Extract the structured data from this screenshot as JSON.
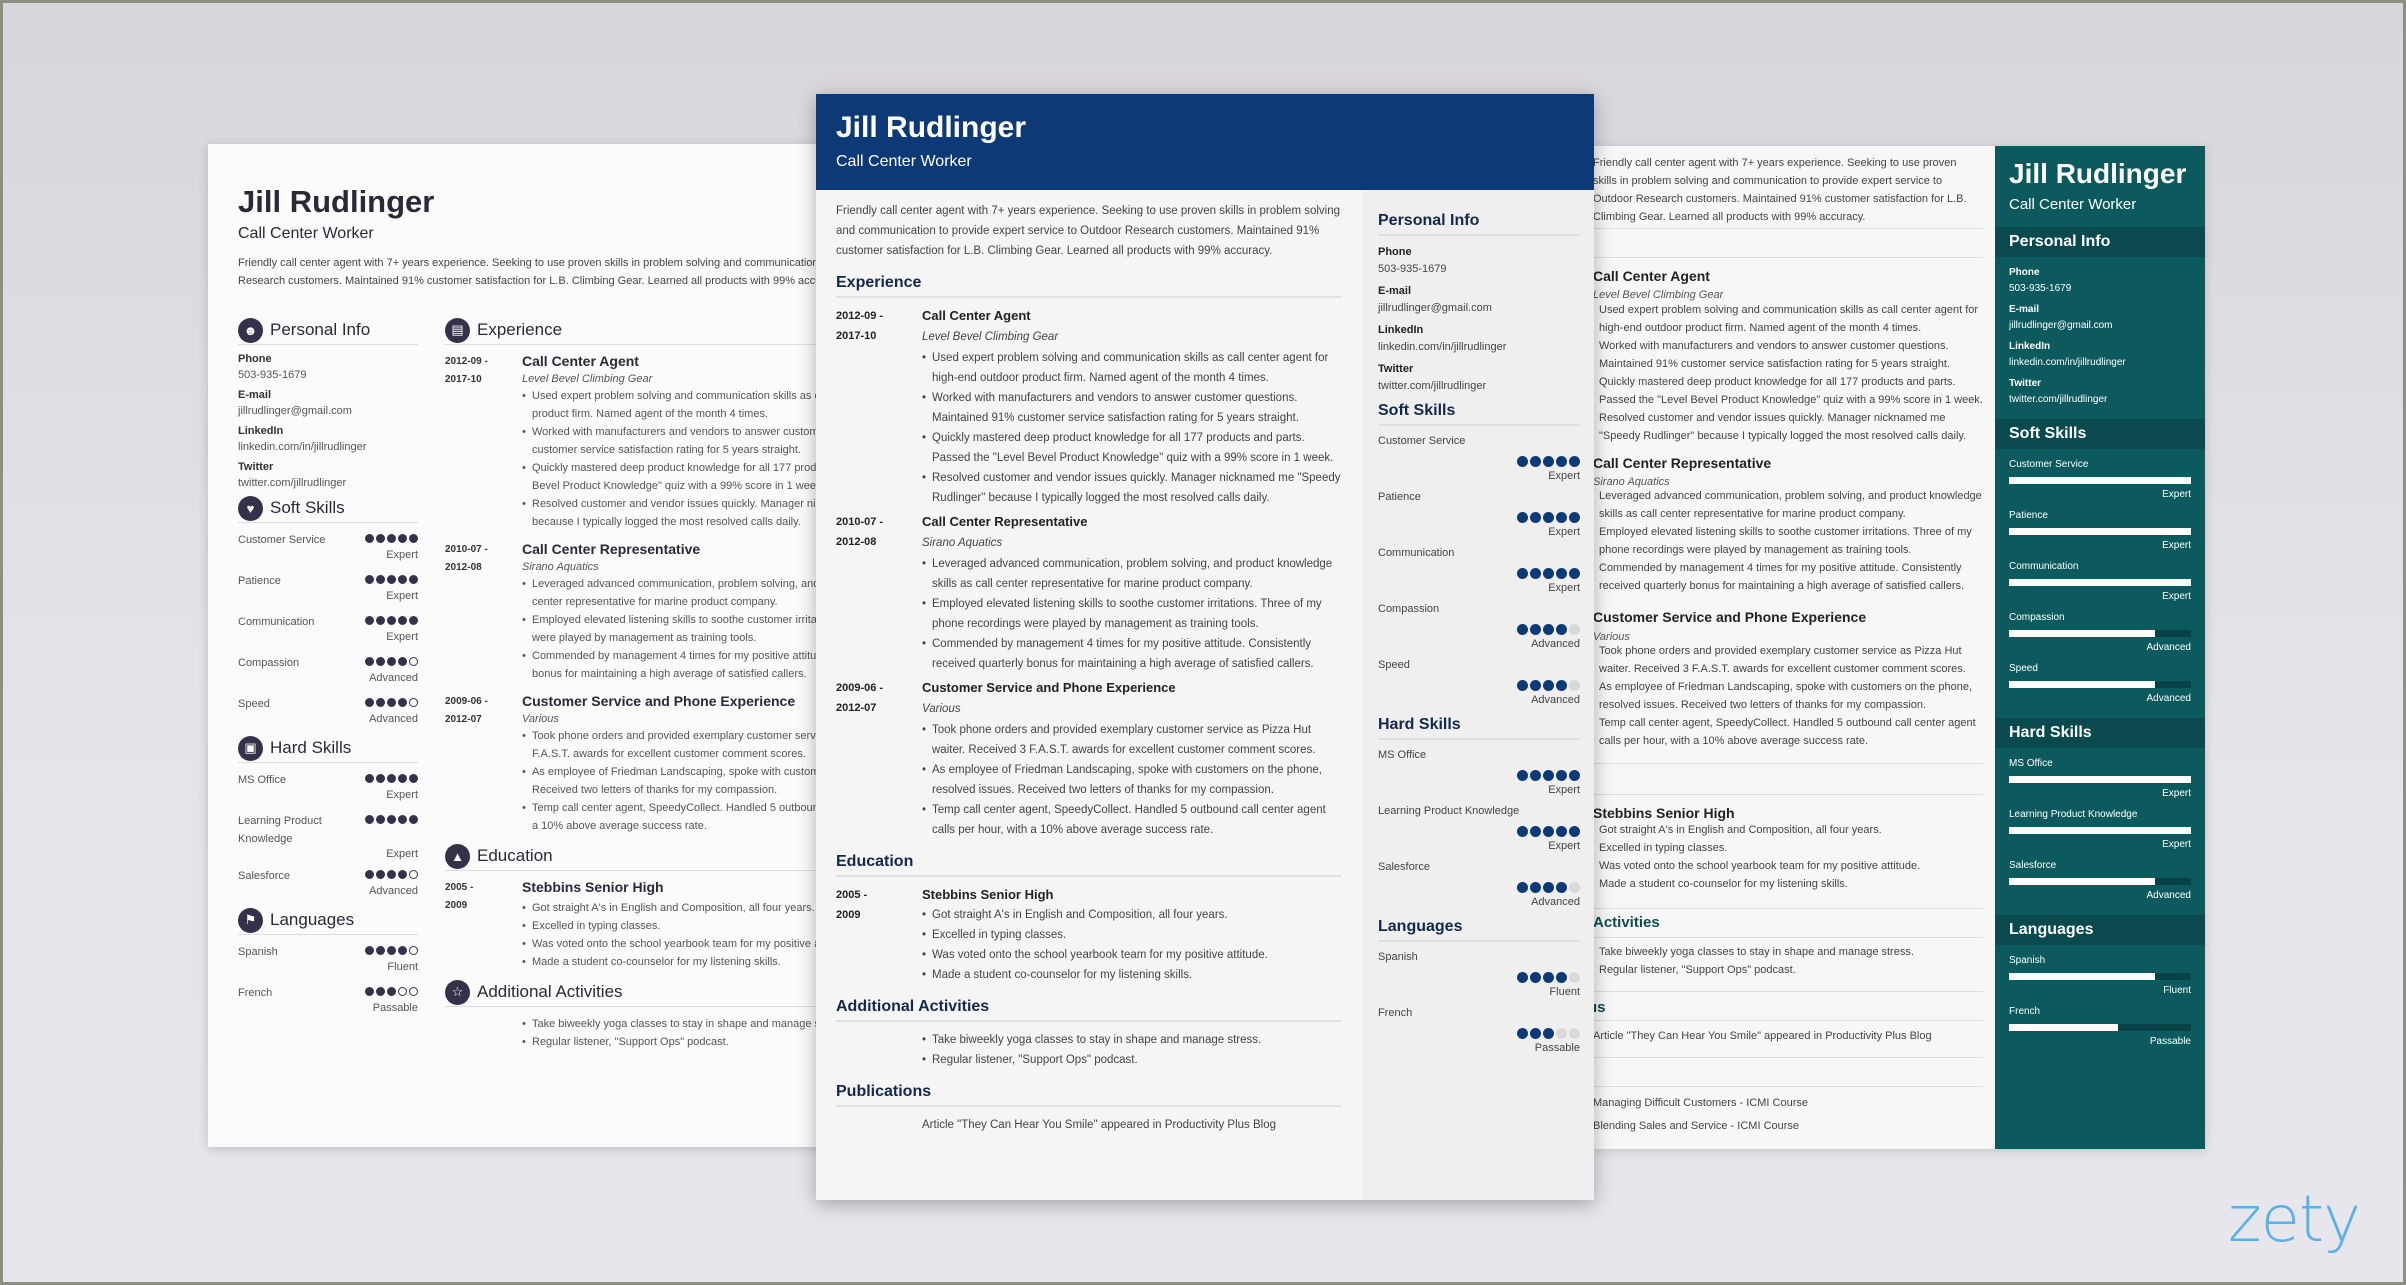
{
  "person": {
    "name": "Jill Rudlinger",
    "title": "Call Center Worker",
    "summary": "Friendly call center agent with 7+ years experience. Seeking to use proven skills in problem solving and communication to provide expert service to Outdoor Research customers. Maintained 91% customer satisfaction for L.B. Climbing Gear. Learned all products with 99% accuracy."
  },
  "colors": {
    "center_accent": "#0d3a76",
    "left_accent": "#36304a",
    "right_accent": "#0d5a5e",
    "logo": "#5bb0e6"
  },
  "sections": {
    "personal_info": "Personal Info",
    "experience": "Experience",
    "soft_skills": "Soft Skills",
    "hard_skills": "Hard Skills",
    "languages": "Languages",
    "education": "Education",
    "additional_activities": "Additional Activities",
    "publications": "Publications",
    "activities_partial": "Activities",
    "publications_partial": "ıs"
  },
  "personal_info": [
    {
      "label": "Phone",
      "value": "503-935-1679"
    },
    {
      "label": "E-mail",
      "value": "jillrudlinger@gmail.com"
    },
    {
      "label": "LinkedIn",
      "value": "linkedin.com/in/jillrudlinger"
    },
    {
      "label": "Twitter",
      "value": "twitter.com/jillrudlinger"
    }
  ],
  "soft_skills": [
    {
      "name": "Customer Service",
      "level": "Expert",
      "rating": 5,
      "max": 5
    },
    {
      "name": "Patience",
      "level": "Expert",
      "rating": 5,
      "max": 5
    },
    {
      "name": "Communication",
      "level": "Expert",
      "rating": 5,
      "max": 5
    },
    {
      "name": "Compassion",
      "level": "Advanced",
      "rating": 4,
      "max": 5
    },
    {
      "name": "Speed",
      "level": "Advanced",
      "rating": 4,
      "max": 5
    }
  ],
  "hard_skills": [
    {
      "name": "MS Office",
      "level": "Expert",
      "rating": 5,
      "max": 5
    },
    {
      "name": "Learning Product Knowledge",
      "level": "Expert",
      "rating": 5,
      "max": 5
    },
    {
      "name": "Salesforce",
      "level": "Advanced",
      "rating": 4,
      "max": 5
    }
  ],
  "languages": [
    {
      "name": "Spanish",
      "level": "Fluent",
      "rating": 4,
      "max": 5
    },
    {
      "name": "French",
      "level": "Passable",
      "rating": 3,
      "max": 5
    }
  ],
  "experience": [
    {
      "date_start": "2012-09 -",
      "date_end": "2017-10",
      "title": "Call Center Agent",
      "company": "Level Bevel Climbing Gear",
      "bullets": [
        "Used expert problem solving and communication skills as call center agent for high-end outdoor product firm. Named agent of the month 4 times.",
        "Worked with manufacturers and vendors to answer customer questions. Maintained 91% customer service satisfaction rating for 5 years straight.",
        "Quickly mastered deep product knowledge for all 177 products and parts. Passed the \"Level Bevel Product Knowledge\" quiz with a 99% score in 1 week.",
        "Resolved customer and vendor issues quickly. Manager nicknamed me \"Speedy Rudlinger\" because I typically logged the most resolved calls daily."
      ]
    },
    {
      "date_start": "2010-07 -",
      "date_end": "2012-08",
      "title": "Call Center Representative",
      "company": "Sirano Aquatics",
      "bullets": [
        "Leveraged advanced communication, problem solving, and product knowledge skills as call center representative for marine product company.",
        "Employed elevated listening skills to soothe customer irritations. Three of my phone recordings were played by management as training tools.",
        "Commended by management 4 times for my positive attitude. Consistently received quarterly bonus for maintaining a high average of satisfied callers."
      ]
    },
    {
      "date_start": "2009-06 -",
      "date_end": "2012-07",
      "title": "Customer Service and Phone Experience",
      "company": "Various",
      "bullets": [
        "Took phone orders and provided exemplary customer service as Pizza Hut waiter. Received 3 F.A.S.T. awards for excellent customer comment scores.",
        "As employee of Friedman Landscaping, spoke with customers on the phone, resolved issues. Received two letters of thanks for my compassion.",
        "Temp call center agent, SpeedyCollect. Handled 5 outbound call center agent calls per hour, with a 10% above average success rate."
      ]
    }
  ],
  "education": [
    {
      "date_start": "2005 -",
      "date_end": "2009",
      "school": "Stebbins Senior High",
      "bullets": [
        "Got straight A's in English and Composition, all four years.",
        "Excelled in typing classes.",
        "Was voted onto the school yearbook team for my positive attitude.",
        "Made a student co-counselor for my listening skills."
      ]
    }
  ],
  "activities": [
    "Take biweekly yoga classes to stay in shape and manage stress.",
    "Regular listener, \"Support Ops\" podcast."
  ],
  "publications": [
    "Article \"They Can Hear You Smile\" appeared in Productivity Plus Blog"
  ],
  "certifications": [
    "Managing Difficult Customers - ICMI Course",
    "Blending Sales and Service - ICMI Course"
  ],
  "brand": {
    "logo_text": "zety"
  }
}
